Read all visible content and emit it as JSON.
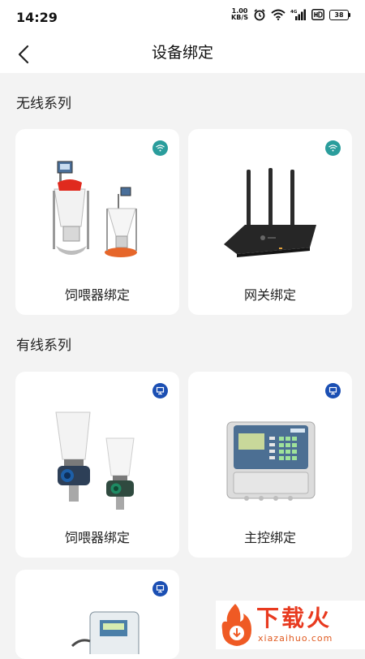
{
  "status_bar": {
    "time": "14:29",
    "net_speed_value": "1.00",
    "net_speed_unit": "KB/S",
    "signal_label": "4G",
    "battery_level": "38"
  },
  "nav": {
    "title": "设备绑定"
  },
  "sections": {
    "wireless": {
      "title": "无线系列"
    },
    "wired": {
      "title": "有线系列"
    }
  },
  "cards": {
    "wireless_feeder": {
      "label": "饲喂器绑定",
      "badge": "wifi-icon"
    },
    "gateway": {
      "label": "网关绑定",
      "badge": "wifi-icon"
    },
    "wired_feeder": {
      "label": "饲喂器绑定",
      "badge": "wired-device-icon"
    },
    "main_control": {
      "label": "主控绑定",
      "badge": "wired-device-icon"
    },
    "partial_device": {
      "label": "",
      "badge": "wired-device-icon"
    }
  },
  "colors": {
    "wifi_badge": "#2a9d9c",
    "wired_badge": "#1b4fb3",
    "background": "#f3f3f3",
    "card": "#ffffff"
  },
  "watermark": {
    "title": "下载火",
    "url": "xiazaihuo.com"
  }
}
